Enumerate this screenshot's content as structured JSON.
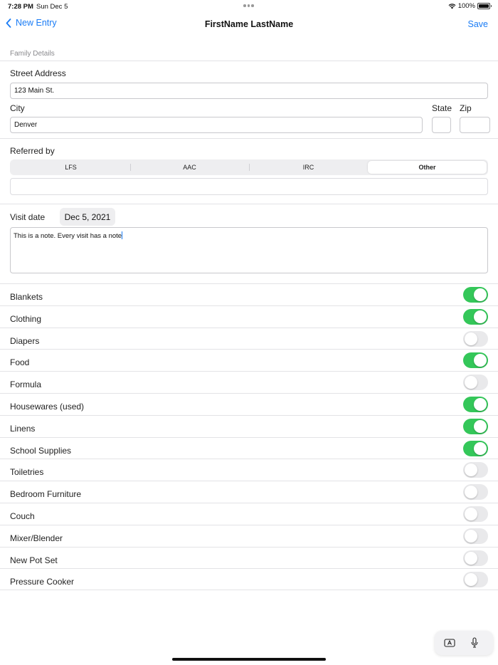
{
  "status": {
    "time": "7:28 PM",
    "date": "Sun Dec 5",
    "battery": "100%"
  },
  "nav": {
    "back_label": "New Entry",
    "title": "FirstName LastName",
    "save_label": "Save"
  },
  "section": {
    "header": "Family Details"
  },
  "address": {
    "street_label": "Street Address",
    "street_value": "123 Main St.",
    "city_label": "City",
    "city_value": "Denver",
    "state_label": "State",
    "state_value": "",
    "zip_label": "Zip",
    "zip_value": ""
  },
  "referred": {
    "label": "Referred by",
    "options": [
      "LFS",
      "AAC",
      "IRC",
      "Other"
    ],
    "selected": "Other",
    "other_value": ""
  },
  "visit": {
    "label": "Visit date",
    "date": "Dec 5, 2021",
    "note": "This is a note. Every visit has a note"
  },
  "items": [
    {
      "label": "Blankets",
      "on": true
    },
    {
      "label": "Clothing",
      "on": true
    },
    {
      "label": "Diapers",
      "on": false
    },
    {
      "label": "Food",
      "on": true
    },
    {
      "label": "Formula",
      "on": false
    },
    {
      "label": "Housewares (used)",
      "on": true
    },
    {
      "label": "Linens",
      "on": true
    },
    {
      "label": "School Supplies",
      "on": true
    },
    {
      "label": "Toiletries",
      "on": false
    },
    {
      "label": "Bedroom Furniture",
      "on": false
    },
    {
      "label": "Couch",
      "on": false
    },
    {
      "label": "Mixer/Blender",
      "on": false
    },
    {
      "label": "New Pot Set",
      "on": false
    },
    {
      "label": "Pressure Cooker",
      "on": false
    }
  ],
  "colors": {
    "accent": "#1a7cf5",
    "switch_on": "#34c759",
    "switch_off": "#e9e9eb"
  },
  "icons": [
    "wifi-icon",
    "battery-icon",
    "chevron-left-icon",
    "keyboard-icon",
    "microphone-icon"
  ]
}
